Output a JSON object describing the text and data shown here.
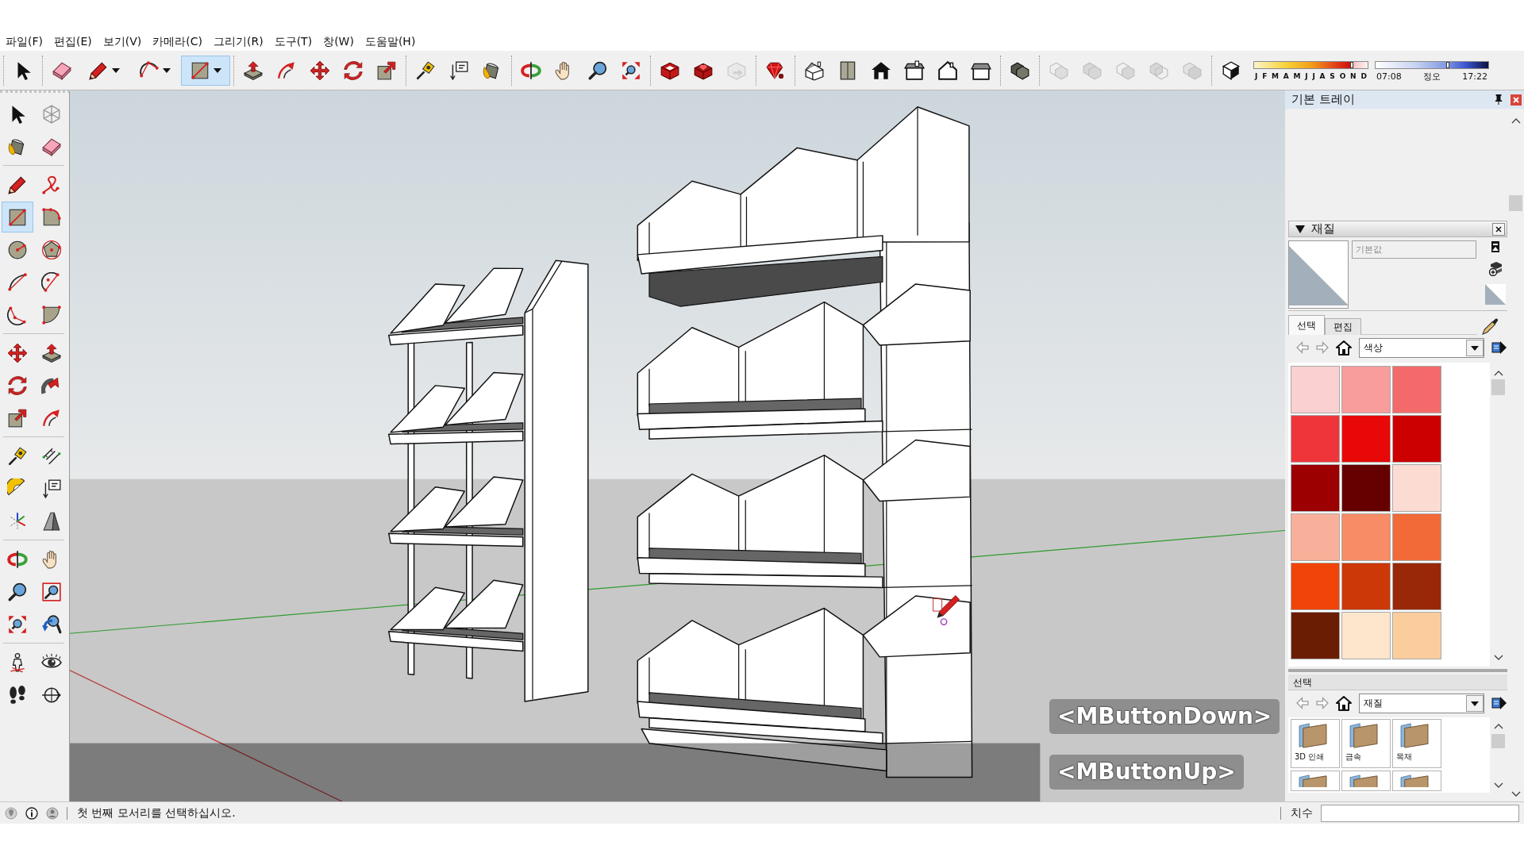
{
  "menu_bar": [
    "파일(F)",
    "편집(E)",
    "보기(V)",
    "카메라(C)",
    "그리기(R)",
    "도구(T)",
    "창(W)",
    "도움말(H)"
  ],
  "top_toolbar": [
    [
      {
        "kind": "select",
        "selected": false
      }
    ],
    [
      {
        "kind": "eraser",
        "selected": false
      },
      {
        "kind": "pencil",
        "selected": false
      },
      {
        "kind": "arc",
        "selected": false
      },
      {
        "kind": "rectangle",
        "selected": true
      }
    ],
    [
      {
        "kind": "pushpull",
        "selected": false
      },
      {
        "kind": "offset",
        "selected": false
      },
      {
        "kind": "move",
        "selected": false
      },
      {
        "kind": "rotate",
        "selected": false
      },
      {
        "kind": "scale",
        "selected": false
      }
    ],
    [
      {
        "kind": "tape",
        "selected": false
      },
      {
        "kind": "text",
        "selected": false
      },
      {
        "kind": "paint",
        "selected": false
      }
    ],
    [
      {
        "kind": "orbit",
        "selected": false
      },
      {
        "kind": "pan",
        "selected": false
      },
      {
        "kind": "zoom",
        "selected": false
      },
      {
        "kind": "extents",
        "selected": false
      }
    ],
    [
      {
        "kind": "warehouse",
        "selected": false,
        "disabled": false
      },
      {
        "kind": "extensions",
        "selected": false,
        "disabled": false
      },
      {
        "kind": "share",
        "selected": false,
        "disabled": true
      }
    ],
    [
      {
        "kind": "ruby",
        "selected": false
      }
    ],
    [
      {
        "kind": "iso",
        "selected": false
      },
      {
        "kind": "top",
        "selected": false
      },
      {
        "kind": "front",
        "selected": false
      },
      {
        "kind": "right",
        "selected": false
      },
      {
        "kind": "back",
        "selected": false
      },
      {
        "kind": "left",
        "selected": false
      }
    ],
    [
      {
        "kind": "outershell",
        "selected": false,
        "disabled": false
      }
    ],
    [
      {
        "kind": "intersect",
        "selected": false,
        "disabled": true
      },
      {
        "kind": "union",
        "selected": false,
        "disabled": true
      },
      {
        "kind": "subtract",
        "selected": false,
        "disabled": true
      },
      {
        "kind": "trim",
        "selected": false,
        "disabled": true
      },
      {
        "kind": "split",
        "selected": false,
        "disabled": true
      }
    ],
    [
      {
        "kind": "shadows",
        "selected": false
      }
    ]
  ],
  "shadow_sliders": {
    "date": {
      "labels": [
        "J",
        "F",
        "M",
        "A",
        "M",
        "J",
        "J",
        "A",
        "S",
        "O",
        "N",
        "D"
      ],
      "level": 0.86
    },
    "time": {
      "labels": [
        "07:08",
        "정오",
        "17:22"
      ],
      "level": 0.64
    }
  },
  "left_toolbar": [
    [
      {
        "kind": "select",
        "selected": false
      },
      {
        "kind": "component",
        "selected": false
      },
      {
        "kind": "paint",
        "selected": false
      },
      {
        "kind": "eraser",
        "selected": false
      }
    ],
    [
      {
        "kind": "pencil",
        "selected": false
      },
      {
        "kind": "freehand",
        "selected": false
      },
      {
        "kind": "rectangle",
        "selected": true
      },
      {
        "kind": "rotrect",
        "selected": false
      },
      {
        "kind": "circle",
        "selected": false
      },
      {
        "kind": "polygon",
        "selected": false
      },
      {
        "kind": "arc1",
        "selected": false
      },
      {
        "kind": "arc2",
        "selected": false
      },
      {
        "kind": "arc3",
        "selected": false
      },
      {
        "kind": "pie",
        "selected": false
      }
    ],
    [
      {
        "kind": "move",
        "selected": false
      },
      {
        "kind": "pushpull",
        "selected": false
      },
      {
        "kind": "rotate",
        "selected": false
      },
      {
        "kind": "followme",
        "selected": false
      },
      {
        "kind": "scale",
        "selected": false
      },
      {
        "kind": "offset",
        "selected": false
      }
    ],
    [
      {
        "kind": "tape",
        "selected": false
      },
      {
        "kind": "dimension",
        "selected": false
      },
      {
        "kind": "protractor",
        "selected": false
      },
      {
        "kind": "text",
        "selected": false
      },
      {
        "kind": "axes",
        "selected": false
      },
      {
        "kind": "text3d",
        "selected": false
      }
    ],
    [
      {
        "kind": "orbit",
        "selected": false
      },
      {
        "kind": "pan",
        "selected": false
      },
      {
        "kind": "zoom",
        "selected": false
      },
      {
        "kind": "zoomwindow",
        "selected": false
      },
      {
        "kind": "extents",
        "selected": false
      },
      {
        "kind": "previous",
        "selected": false
      }
    ],
    [
      {
        "kind": "camera",
        "selected": false
      },
      {
        "kind": "lookaround",
        "selected": false
      },
      {
        "kind": "walk",
        "selected": false
      },
      {
        "kind": "section",
        "selected": false
      }
    ]
  ],
  "viewport": {
    "keystrokes": [
      "<MButtonDown>",
      "<MButtonUp>"
    ]
  },
  "tray": {
    "title": "기본 트레이",
    "materials": {
      "title": "재질",
      "expanded": true,
      "name": {
        "value": "기본값",
        "disabled": true
      },
      "tabs": [
        {
          "label": "선택",
          "selected": true
        },
        {
          "label": "편집",
          "selected": false
        }
      ],
      "library": "색상",
      "swatches": [
        {
          "color": "#fbd0d0"
        },
        {
          "color": "#f89c9c"
        },
        {
          "color": "#f46a6a"
        },
        {
          "color": "#f0353a"
        },
        {
          "color": "#e80808"
        },
        {
          "color": "#cc0000"
        },
        {
          "color": "#9c0000"
        },
        {
          "color": "#660000"
        },
        {
          "color": "#fcdcd2"
        },
        {
          "color": "#f8b09a"
        },
        {
          "color": "#f78c66"
        },
        {
          "color": "#f26a38"
        },
        {
          "color": "#f04408"
        },
        {
          "color": "#cc3808"
        },
        {
          "color": "#982808"
        },
        {
          "color": "#6b1d04"
        },
        {
          "color": "#fde6cc"
        },
        {
          "color": "#fbcd9d"
        }
      ],
      "secondary": {
        "title": "선택",
        "library": "재질",
        "items": [
          {
            "kind": "folder",
            "label": "3D 인쇄"
          },
          {
            "kind": "folder",
            "label": "금속"
          },
          {
            "kind": "folder",
            "label": "목재"
          },
          {
            "kind": "folder"
          },
          {
            "kind": "folder"
          },
          {
            "kind": "folder"
          }
        ]
      }
    }
  },
  "status_bar": {
    "message": "첫 번째 모서리를 선택하십시오.",
    "measurements_label": "치수"
  }
}
